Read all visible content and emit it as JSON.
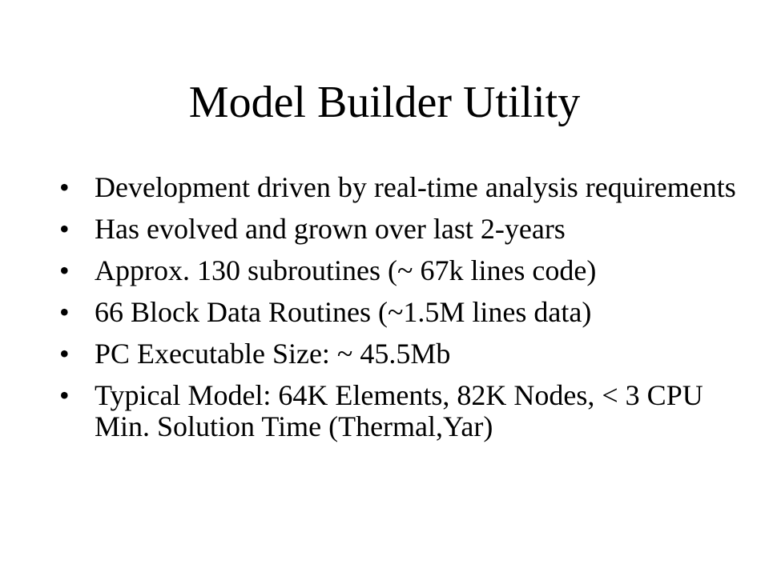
{
  "slide": {
    "title": "Model Builder Utility",
    "bullet_symbol": "•",
    "bullets": [
      "Development driven by real-time analysis requirements",
      "Has evolved and grown over last 2-years",
      "Approx. 130 subroutines (~ 67k lines code)",
      "66 Block Data Routines (~1.5M lines data)",
      "PC Executable Size: ~ 45.5Mb",
      "Typical Model: 64K Elements, 82K Nodes, < 3 CPU Min. Solution Time (Thermal,Yar)"
    ]
  }
}
